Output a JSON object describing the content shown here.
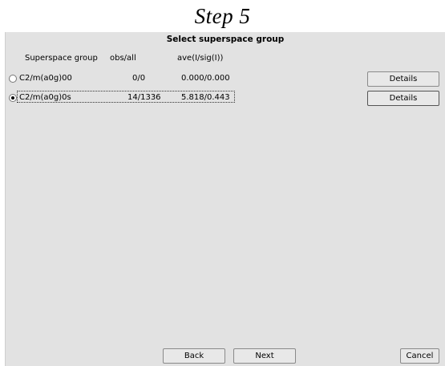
{
  "step_title": "Step 5",
  "dialog": {
    "title": "Select superspace group",
    "headers": {
      "group": "Superspace group",
      "obs": "obs/all",
      "ave": "ave(I/sig(I))"
    },
    "rows": [
      {
        "group": "C2/m(a0g)00",
        "obs": "0/0",
        "ave": "0.000/0.000",
        "selected": false,
        "details_label": "Details"
      },
      {
        "group": "C2/m(a0g)0s",
        "obs": "14/1336",
        "ave": "5.818/0.443",
        "selected": true,
        "details_label": "Details"
      }
    ],
    "buttons": {
      "back": "Back",
      "next": "Next",
      "cancel": "Cancel"
    }
  }
}
